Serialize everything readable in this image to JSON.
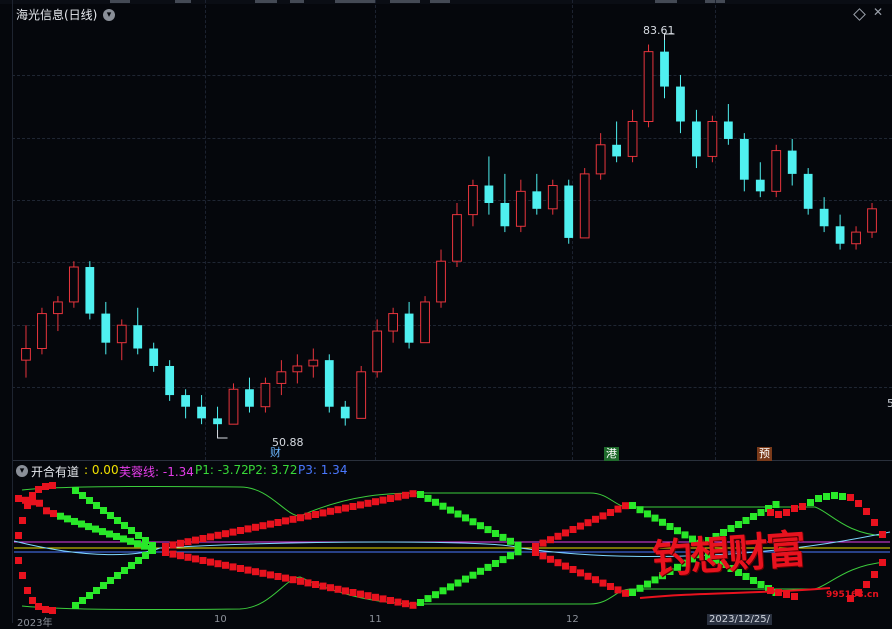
{
  "header": {
    "title": "海光信息(日线)",
    "dropdown_icon": "chevron-down-icon",
    "right_icons": [
      "diamond-icon",
      "close-icon"
    ]
  },
  "main_chart": {
    "high_label": "83.61",
    "low_label": "50.88",
    "right_axis_fragment": "5",
    "markers": [
      {
        "text": "财",
        "color": "#6ab6ff"
      },
      {
        "text": "港",
        "bg": "#1f6b2c",
        "color": "#ffffff"
      },
      {
        "text": "预",
        "bg": "#7a3a1a",
        "color": "#ffffff"
      }
    ],
    "colors": {
      "up": "#e8353d",
      "down": "#4ff0f0"
    }
  },
  "indicator": {
    "name": "开合有道",
    "values": [
      {
        "label": ": 0.00",
        "color": "#f0e000"
      },
      {
        "label": "芙蓉线: -1.34",
        "color": "#e43ce8"
      },
      {
        "label": "P1: -3.72",
        "color": "#38d838"
      },
      {
        "label": "P2: 3.72",
        "color": "#38d838"
      },
      {
        "label": "P3: 1.34",
        "color": "#4a78ff"
      }
    ],
    "dropdown_icon": "chevron-down-icon"
  },
  "x_axis": {
    "labels": [
      "2023年",
      "10",
      "11",
      "12",
      "2023/12/25/"
    ]
  },
  "watermark": {
    "text": "钓想财富",
    "url": "995168.cn"
  },
  "chart_data": {
    "type": "candlestick",
    "title": "海光信息(日线)",
    "annotations": [
      {
        "text": "83.61",
        "kind": "period-high"
      },
      {
        "text": "50.88",
        "kind": "period-low"
      }
    ],
    "ohlc_sample": [
      [
        56.5,
        59.5,
        55.0,
        57.5
      ],
      [
        57.5,
        61.0,
        57.0,
        60.5
      ],
      [
        60.5,
        62.0,
        59.0,
        61.5
      ],
      [
        61.5,
        65.0,
        61.0,
        64.5
      ],
      [
        64.5,
        65.0,
        60.0,
        60.5
      ],
      [
        60.5,
        61.5,
        57.0,
        58.0
      ],
      [
        58.0,
        60.0,
        56.5,
        59.5
      ],
      [
        59.5,
        61.0,
        57.0,
        57.5
      ],
      [
        57.5,
        58.0,
        55.5,
        56.0
      ],
      [
        56.0,
        56.5,
        53.0,
        53.5
      ],
      [
        53.5,
        54.0,
        51.5,
        52.5
      ],
      [
        52.5,
        53.5,
        51.0,
        51.5
      ],
      [
        51.5,
        52.5,
        50.5,
        51.0
      ],
      [
        51.0,
        54.5,
        51.0,
        54.0
      ],
      [
        54.0,
        55.0,
        52.0,
        52.5
      ],
      [
        52.5,
        55.0,
        52.0,
        54.5
      ],
      [
        54.5,
        56.5,
        53.5,
        55.5
      ],
      [
        55.5,
        57.0,
        54.5,
        56.0
      ],
      [
        56.0,
        57.5,
        55.0,
        56.5
      ],
      [
        56.5,
        57.0,
        52.0,
        52.5
      ],
      [
        52.5,
        53.0,
        50.88,
        51.5
      ],
      [
        51.5,
        56.0,
        51.5,
        55.5
      ],
      [
        55.5,
        60.0,
        55.0,
        59.0
      ],
      [
        59.0,
        61.0,
        58.0,
        60.5
      ],
      [
        60.5,
        61.5,
        57.5,
        58.0
      ],
      [
        58.0,
        62.0,
        58.0,
        61.5
      ],
      [
        61.5,
        66.0,
        61.0,
        65.0
      ],
      [
        65.0,
        70.0,
        64.5,
        69.0
      ],
      [
        69.0,
        72.0,
        68.0,
        71.5
      ],
      [
        71.5,
        74.0,
        69.0,
        70.0
      ],
      [
        70.0,
        72.5,
        67.5,
        68.0
      ],
      [
        68.0,
        72.0,
        67.5,
        71.0
      ],
      [
        71.0,
        72.5,
        69.0,
        69.5
      ],
      [
        69.5,
        72.0,
        69.0,
        71.5
      ],
      [
        71.5,
        72.0,
        66.5,
        67.0
      ],
      [
        67.0,
        73.0,
        67.0,
        72.5
      ],
      [
        72.5,
        76.0,
        72.0,
        75.0
      ],
      [
        75.0,
        77.0,
        73.5,
        74.0
      ],
      [
        74.0,
        78.0,
        73.5,
        77.0
      ],
      [
        77.0,
        83.61,
        76.5,
        83.0
      ],
      [
        83.0,
        84.0,
        79.0,
        80.0
      ],
      [
        80.0,
        81.0,
        76.0,
        77.0
      ],
      [
        77.0,
        78.0,
        73.0,
        74.0
      ],
      [
        74.0,
        77.5,
        73.5,
        77.0
      ],
      [
        77.0,
        78.5,
        75.0,
        75.5
      ],
      [
        75.5,
        76.0,
        71.0,
        72.0
      ],
      [
        72.0,
        73.5,
        70.5,
        71.0
      ],
      [
        71.0,
        75.0,
        70.5,
        74.5
      ],
      [
        74.5,
        75.5,
        71.5,
        72.5
      ],
      [
        72.5,
        73.0,
        69.0,
        69.5
      ],
      [
        69.5,
        70.5,
        67.5,
        68.0
      ],
      [
        68.0,
        69.0,
        66.0,
        66.5
      ],
      [
        66.5,
        68.0,
        66.0,
        67.5
      ],
      [
        67.5,
        70.0,
        67.0,
        69.5
      ]
    ]
  }
}
